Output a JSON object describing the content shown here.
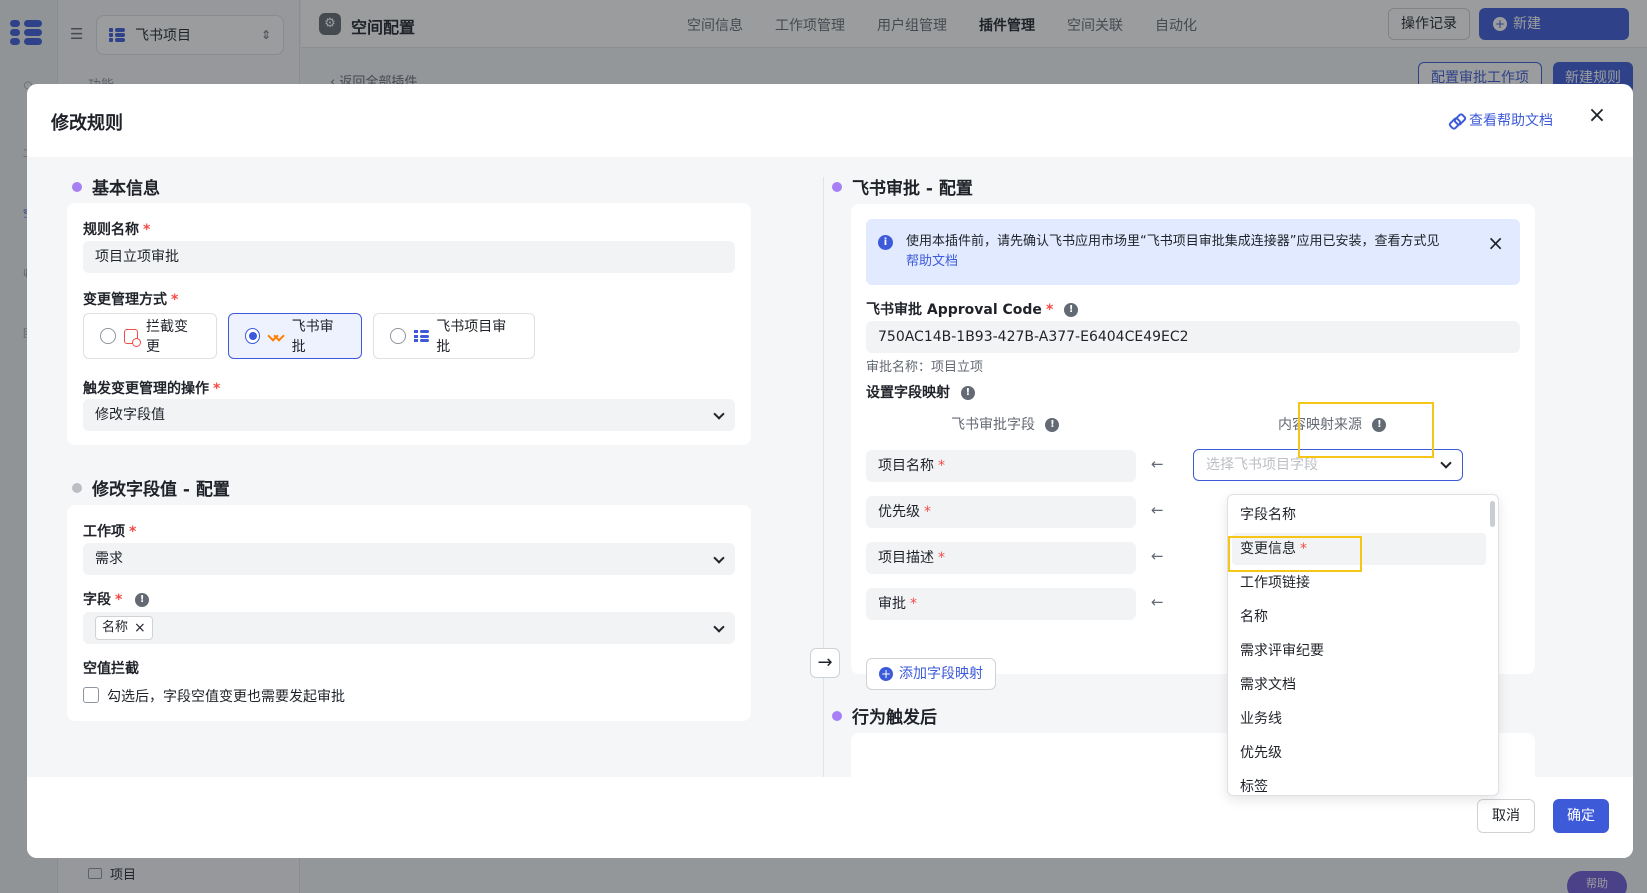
{
  "background": {
    "project_selector": "飞书项目",
    "side_label": "功能",
    "side_bottom_item": "项目",
    "page_title": "空间配置",
    "tabs": [
      "空间信息",
      "工作项管理",
      "用户组管理",
      "插件管理",
      "空间关联",
      "自动化"
    ],
    "active_tab": "插件管理",
    "log_button": "操作记录",
    "new_button": "新建",
    "back_link": "‹ 返回全部插件",
    "config_button": "配置审批工作项",
    "new_rule_button": "新建规则",
    "help_bubble": "帮助",
    "rail_labels": [
      "工",
      "空",
      "收",
      "团"
    ]
  },
  "modal": {
    "title": "修改规则",
    "help_link": "查看帮助文档",
    "cancel": "取消",
    "confirm": "确定"
  },
  "basic": {
    "section_title": "基本信息",
    "rule_name_label": "规则名称",
    "rule_name_value": "项目立项审批",
    "change_mode_label": "变更管理方式",
    "options": [
      "拦截变更",
      "飞书审批",
      "飞书项目审批"
    ],
    "selected_option": "飞书审批",
    "trigger_label": "触发变更管理的操作",
    "trigger_value": "修改字段值"
  },
  "modify": {
    "section_title": "修改字段值 - 配置",
    "workitem_label": "工作项",
    "workitem_value": "需求",
    "field_label": "字段",
    "field_tag": "名称",
    "empty_label": "空值拦截",
    "empty_checkbox_text": "勾选后，字段空值变更也需要发起审批"
  },
  "approval": {
    "section_title": "飞书审批 - 配置",
    "notice_text": "使用本插件前，请先确认飞书应用市场里“飞书项目审批集成连接器”应用已安装，查看方式见",
    "notice_link": "帮助文档",
    "code_label": "飞书审批 Approval Code",
    "code_value": "750AC14B-1B93-427B-A377-E6404CE49EC2",
    "approval_name": "审批名称：项目立项",
    "mapping_label": "设置字段映射",
    "col_left": "飞书审批字段",
    "col_right": "内容映射来源",
    "rows": [
      "项目名称",
      "优先级",
      "项目描述",
      "审批"
    ],
    "select_placeholder": "选择飞书项目字段",
    "add_mapping": "添加字段映射",
    "after_section_title": "行为触发后"
  },
  "dropdown": {
    "items": [
      "字段名称",
      "变更信息",
      "工作项链接",
      "名称",
      "需求评审纪要",
      "需求文档",
      "业务线",
      "优先级",
      "标签"
    ],
    "highlighted_item": "变更信息",
    "required_marker": "*"
  },
  "colors": {
    "accent": "#3d5bd9",
    "highlight_box": "#f5c518",
    "required": "#f54a45"
  }
}
